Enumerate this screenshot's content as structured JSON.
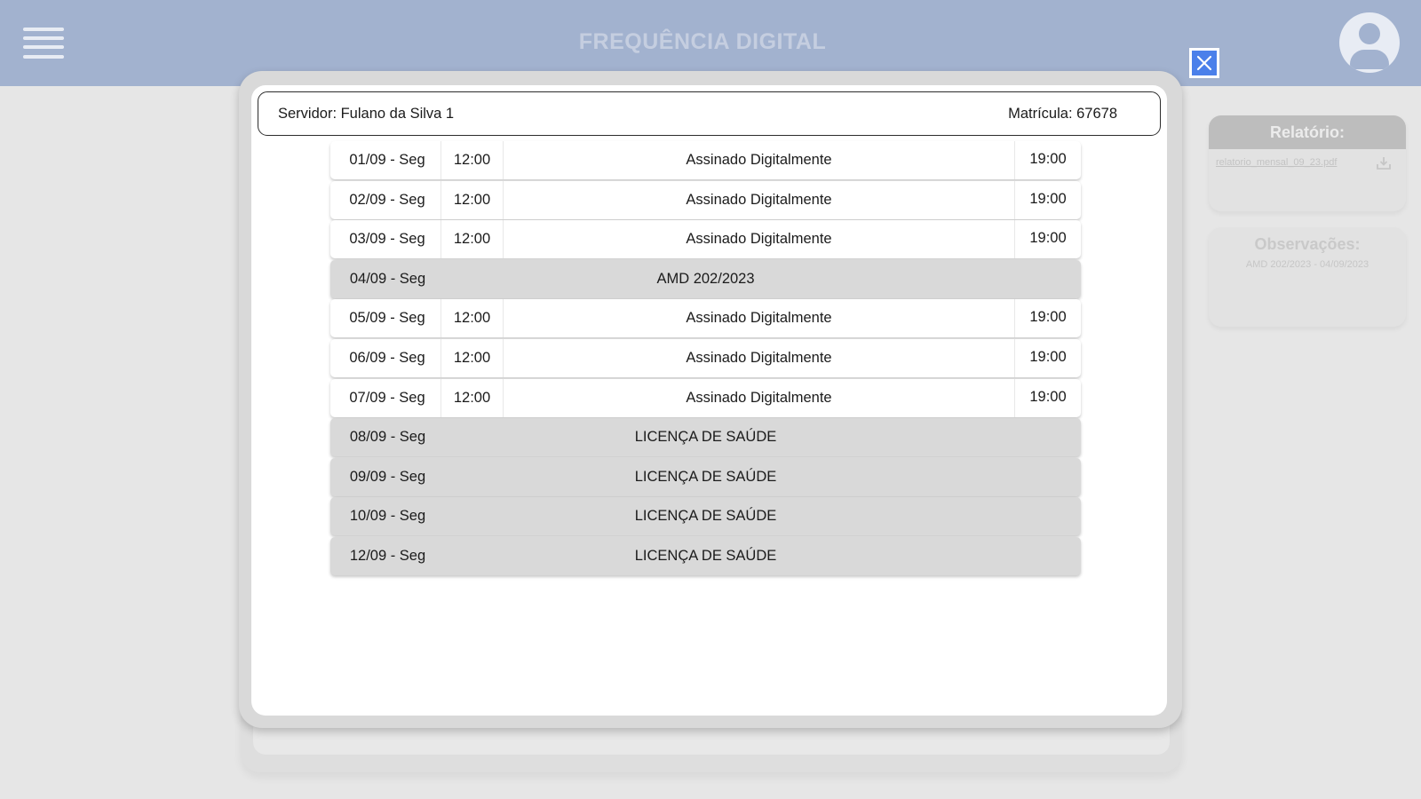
{
  "header": {
    "title": "FREQUÊNCIA DIGITAL"
  },
  "sidebar": {
    "report": {
      "title": "Relatório:",
      "file": "relatorio_mensal_09_23.pdf"
    },
    "observations": {
      "title": "Observações:",
      "text": "AMD 202/2023 - 04/09/2023"
    }
  },
  "modal": {
    "servidor": "Servidor: Fulano da Silva 1",
    "matricula": "Matrícula: 67678",
    "rows": [
      {
        "date": "01/09 - Seg",
        "in": "12:00",
        "status": "Assinado Digitalmente",
        "out": "19:00"
      },
      {
        "date": "02/09 - Seg",
        "in": "12:00",
        "status": "Assinado Digitalmente",
        "out": "19:00"
      },
      {
        "date": "03/09 - Seg",
        "in": "12:00",
        "status": "Assinado Digitalmente",
        "out": "19:00"
      },
      {
        "date": "04/09 - Seg",
        "label": "AMD 202/2023"
      },
      {
        "date": "05/09 - Seg",
        "in": "12:00",
        "status": "Assinado Digitalmente",
        "out": "19:00"
      },
      {
        "date": "06/09 - Seg",
        "in": "12:00",
        "status": "Assinado Digitalmente",
        "out": "19:00"
      },
      {
        "date": "07/09 - Seg",
        "in": "12:00",
        "status": "Assinado Digitalmente",
        "out": "19:00"
      },
      {
        "date": "08/09 - Seg",
        "label": "LICENÇA DE SAÚDE"
      },
      {
        "date": "09/09 - Seg",
        "label": "LICENÇA DE SAÚDE"
      },
      {
        "date": "10/09 - Seg",
        "label": "LICENÇA DE SAÚDE"
      },
      {
        "date": "12/09 - Seg",
        "label": "LICENÇA DE SAÚDE"
      }
    ]
  },
  "colors": {
    "topbar": "#a2b2cf",
    "close_button": "#4b80ea",
    "leave_row": "#d9d9d9"
  }
}
